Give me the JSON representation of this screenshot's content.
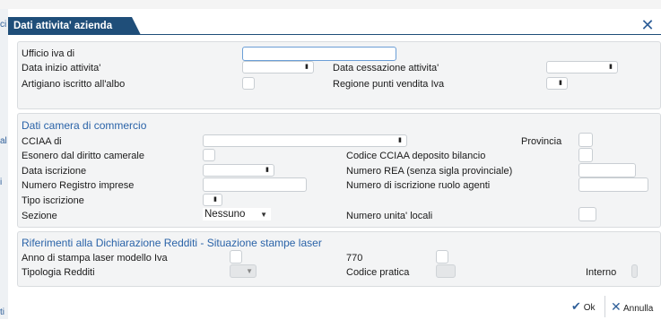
{
  "dialog": {
    "title": "Dati attivita' azienda"
  },
  "section1": {
    "ufficio_iva_label": "Ufficio iva di",
    "data_inizio_label": "Data inizio attivita'",
    "data_cessazione_label": "Data cessazione attivita'",
    "artigiano_label": "Artigiano iscritto all'albo",
    "regione_label": "Regione punti vendita Iva"
  },
  "section2": {
    "title": "Dati camera di commercio",
    "cciaa_label": "CCIAA di",
    "provincia_label": "Provincia",
    "esonero_label": "Esonero dal diritto camerale",
    "codice_cciaa_label": "Codice CCIAA deposito bilancio",
    "data_iscrizione_label": "Data iscrizione",
    "numero_rea_label": "Numero REA (senza sigla provinciale)",
    "numero_registro_label": "Numero Registro imprese",
    "numero_ruolo_label": "Numero di iscrizione ruolo agenti",
    "tipo_iscrizione_label": "Tipo iscrizione",
    "sezione_label": "Sezione",
    "sezione_value": "Nessuno",
    "numero_unita_label": "Numero unita' locali"
  },
  "section3": {
    "title": "Riferimenti alla Dichiarazione Redditi - Situazione stampe laser",
    "anno_label": "Anno di stampa laser modello Iva",
    "label_770": "770",
    "tipologia_label": "Tipologia Redditi",
    "codice_pratica_label": "Codice pratica",
    "interno_label": "Interno"
  },
  "footer": {
    "ok_label": "Ok",
    "annulla_label": "Annulla"
  },
  "background": {
    "left_fragments": [
      "ci",
      "al",
      "i",
      "ti"
    ]
  },
  "icons": {
    "close": "close-icon",
    "calendar": "calendar-icon",
    "dropdown": "chevron-down-icon",
    "ok": "checkmark-icon",
    "cancel": "cancel-x-icon"
  },
  "colors": {
    "title_bg": "#1f4e79",
    "section_title": "#2a63a8",
    "panel_bg": "#f3f4f5",
    "focus_border": "#6b9ed6"
  }
}
